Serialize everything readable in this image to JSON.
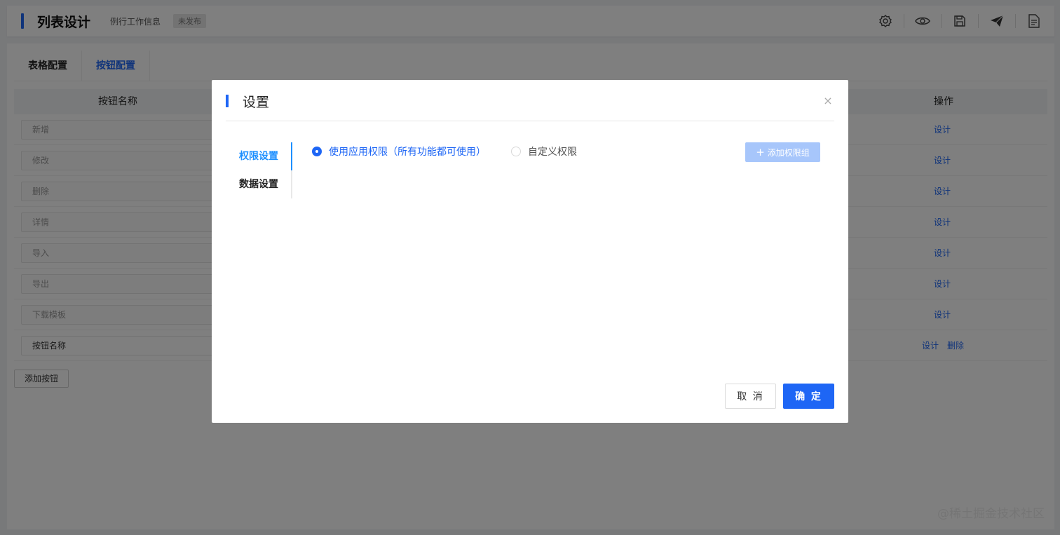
{
  "header": {
    "title": "列表设计",
    "subtitle": "例行工作信息",
    "status_badge": "未发布",
    "tools": [
      "settings-icon",
      "eye-icon",
      "save-icon",
      "send-icon",
      "document-icon"
    ]
  },
  "tabs": [
    {
      "label": "表格配置"
    },
    {
      "label": "按钮配置"
    }
  ],
  "table": {
    "header_name": "按钮名称",
    "header_ops": "操作",
    "rows": [
      {
        "name": "新增",
        "ops": [
          "设计"
        ]
      },
      {
        "name": "修改",
        "ops": [
          "设计"
        ]
      },
      {
        "name": "删除",
        "ops": [
          "设计"
        ]
      },
      {
        "name": "详情",
        "ops": [
          "设计"
        ]
      },
      {
        "name": "导入",
        "ops": [
          "设计"
        ]
      },
      {
        "name": "导出",
        "ops": [
          "设计"
        ]
      },
      {
        "name": "下载模板",
        "ops": [
          "设计"
        ]
      },
      {
        "name": "按钮名称",
        "ops": [
          "设计",
          "删除"
        ]
      }
    ],
    "add_button": "添加按钮"
  },
  "modal": {
    "title": "设置",
    "close_icon": "×",
    "side_items": [
      {
        "label": "权限设置"
      },
      {
        "label": "数据设置"
      }
    ],
    "radios": [
      {
        "label": "使用应用权限（所有功能都可使用）",
        "checked": true
      },
      {
        "label": "自定义权限",
        "checked": false
      }
    ],
    "add_group_icon": "+",
    "add_group_label": "添加权限组",
    "cancel_label": "取 消",
    "ok_label": "确 定"
  },
  "watermark": "@稀土掘金技术社区",
  "colors": {
    "primary": "#1e66f5",
    "active_side": "#1e90ff",
    "disabled_button": "#a7c6fb"
  }
}
